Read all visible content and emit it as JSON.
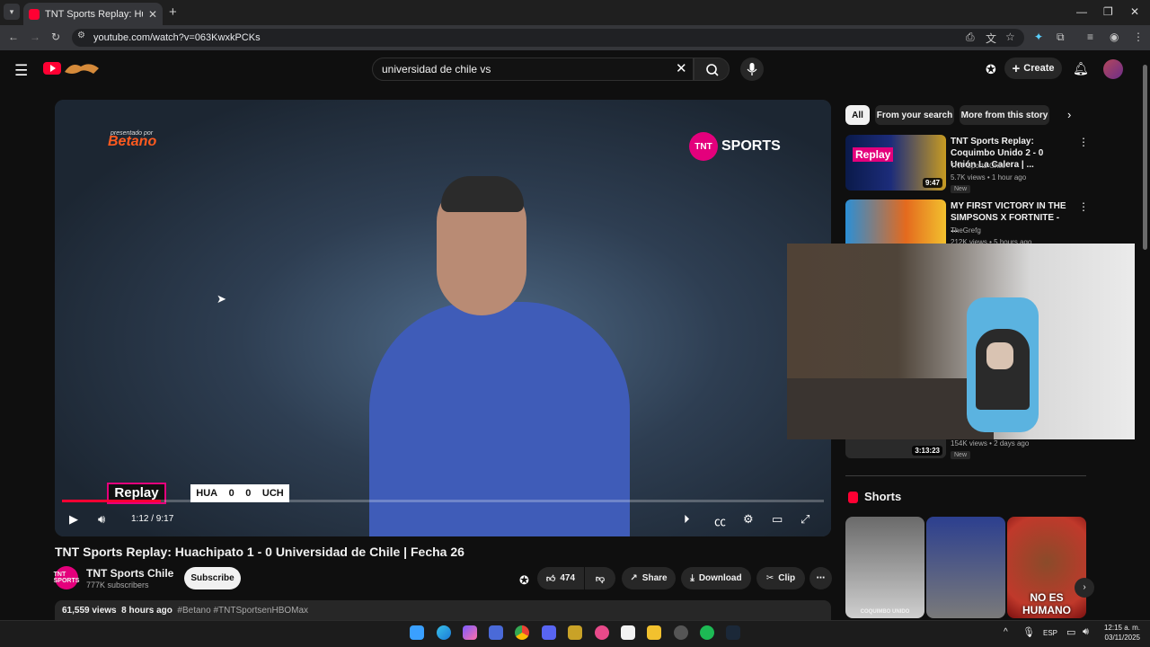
{
  "browser": {
    "tab_title": "TNT Sports Replay: Huachipato",
    "url": "youtube.com/watch?v=063KwxkPCKs",
    "new_tab": "+",
    "tab_close": "✕"
  },
  "header": {
    "search_query": "universidad de chile vs",
    "create_label": "Create"
  },
  "player": {
    "presented_by": "presentado por",
    "sponsor": "Betano",
    "brand": "SPORTS",
    "brand_badge": "TNT",
    "replay_bug": "Replay",
    "score": {
      "home": "HUA",
      "home_goals": "0",
      "away_goals": "0",
      "away": "UCH"
    },
    "time": "1:12 / 9:17",
    "progress": 0.13,
    "accent_color": "#ff0033"
  },
  "video": {
    "title": "TNT Sports Replay: Huachipato 1 - 0 Universidad de Chile | Fecha 26",
    "channel": "TNT Sports Chile",
    "channel_avatar_text": "TNT SPORTS",
    "subscribers": "777K subscribers",
    "subscribe_label": "Subscribe",
    "likes": "474",
    "share_label": "Share",
    "download_label": "Download",
    "clip_label": "Clip",
    "views": "61,559 views",
    "age": "8 hours ago",
    "hashtags": "#Betano #TNTSportsenHBOMax"
  },
  "sidebar": {
    "chips": [
      "All",
      "From your search",
      "More from this story"
    ],
    "recs": [
      {
        "title": "TNT Sports Replay: Coquimbo Unido 2 - 0 Unión La Calera | ...",
        "channel": "TNT Sports Chile",
        "meta": "5.7K views • 1 hour ago",
        "badge": "New",
        "duration": "9:47",
        "thumb_text": "Replay"
      },
      {
        "title": "MY FIRST VICTORY IN THE SIMPSONS X FORTNITE - ...",
        "channel": "TheGrefg",
        "meta": "212K views • 5 hours ago"
      },
      {
        "meta": "154K views • 2 days ago",
        "badge": "New",
        "duration": "3:13:23"
      }
    ],
    "shorts_label": "Shorts",
    "shorts": [
      {
        "caption": "COQUIMBO UNIDO"
      },
      {
        "caption": ""
      },
      {
        "caption": "NO ES HUMANO"
      }
    ]
  },
  "taskbar": {
    "lang": "ESP",
    "time": "12:15 a. m.",
    "date": "03/11/2025"
  },
  "icons": [
    "hamburger-icon",
    "youtube-logo-icon",
    "search-icon",
    "mic-icon",
    "bell-icon",
    "like-icon",
    "dislike-icon",
    "share-icon",
    "download-icon",
    "clip-icon",
    "play-icon",
    "volume-icon",
    "settings-icon",
    "fullscreen-icon"
  ]
}
